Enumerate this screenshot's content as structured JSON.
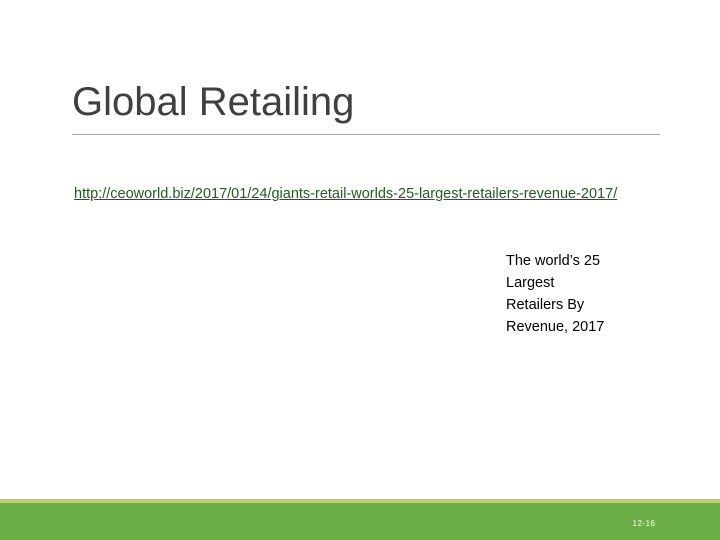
{
  "slide": {
    "title": "Global Retailing",
    "link_text": "http://ceoworld.biz/2017/01/24/giants-retail-worlds-25-largest-retailers-revenue-2017/",
    "caption_lines": [
      "The world’s 25",
      "Largest",
      "Retailers By",
      "Revenue, 2017"
    ],
    "page_number": "12-16"
  },
  "colors": {
    "title_text": "#404040",
    "link_text": "#1f5c1f",
    "footer_bar": "#6aae45",
    "footer_accent": "#b6d36b"
  }
}
